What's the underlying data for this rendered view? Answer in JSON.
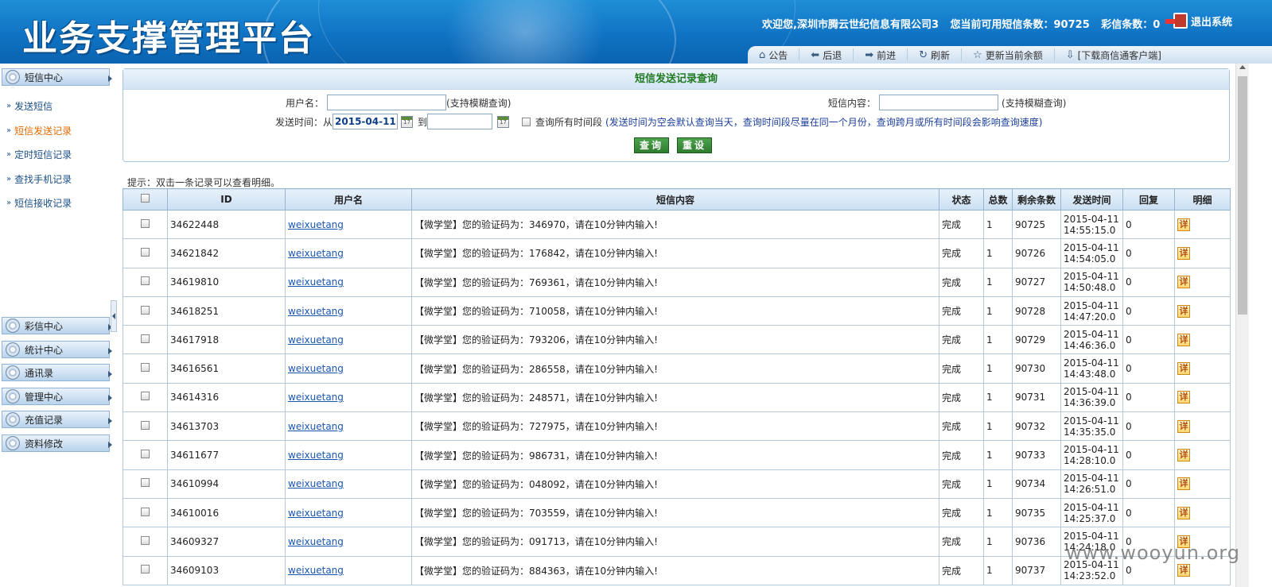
{
  "header": {
    "app_title": "业务支撑管理平台",
    "welcome": "欢迎您,深圳市腾云世纪信息有限公司3",
    "sms_available": "您当前可用短信条数：90725",
    "mms_count": "彩信条数：0",
    "logout": "退出系统"
  },
  "toolbar": [
    {
      "icon": "home-icon",
      "label": "公告"
    },
    {
      "icon": "back-arrow-icon",
      "label": "后退"
    },
    {
      "icon": "forward-arrow-icon",
      "label": "前进"
    },
    {
      "icon": "refresh-icon",
      "label": "刷新"
    },
    {
      "icon": "star-icon",
      "label": "更新当前余额"
    },
    {
      "icon": "download-icon",
      "label": "[下载商信通客户端]"
    }
  ],
  "sidebar": {
    "sms_center": "短信中心",
    "items": [
      {
        "label": "发送短信",
        "active": false
      },
      {
        "label": "短信发送记录",
        "active": true
      },
      {
        "label": "定时短信记录",
        "active": false
      },
      {
        "label": "查找手机记录",
        "active": false
      },
      {
        "label": "短信接收记录",
        "active": false
      }
    ],
    "sections": [
      "彩信中心",
      "统计中心",
      "通讯录",
      "管理中心",
      "充值记录",
      "资料修改"
    ]
  },
  "query": {
    "title": "短信发送记录查询",
    "username_label": "用户名：",
    "username_value": "",
    "fuzzy_hint": "(支持模糊查询)",
    "content_label": "短信内容：",
    "content_value": "",
    "time_label": "发送时间：从",
    "date_from": "2015-04-11",
    "to_label": "到",
    "date_to": "",
    "all_time_label": "查询所有时间段",
    "time_note": "(发送时间为空会默认查询当天，查询时间段尽量在同一个月份，查询跨月或所有时间段会影响查询速度)",
    "search_btn": "查询",
    "reset_btn": "重设"
  },
  "hint": "提示：双击一条记录可以查看明细。",
  "table": {
    "headers": [
      "",
      "ID",
      "用户名",
      "短信内容",
      "状态",
      "总数",
      "剩余条数",
      "发送时间",
      "回复",
      "明细"
    ],
    "detail_label": "详",
    "rows": [
      {
        "id": "34622448",
        "user": "weixuetang",
        "content": "【微学堂】您的验证码为：346970，请在10分钟内输入!",
        "status": "完成",
        "total": "1",
        "remain": "90725",
        "date": "2015-04-11",
        "time": "14:55:15.0",
        "reply": "0"
      },
      {
        "id": "34621842",
        "user": "weixuetang",
        "content": "【微学堂】您的验证码为：176842，请在10分钟内输入!",
        "status": "完成",
        "total": "1",
        "remain": "90726",
        "date": "2015-04-11",
        "time": "14:54:05.0",
        "reply": "0"
      },
      {
        "id": "34619810",
        "user": "weixuetang",
        "content": "【微学堂】您的验证码为：769361，请在10分钟内输入!",
        "status": "完成",
        "total": "1",
        "remain": "90727",
        "date": "2015-04-11",
        "time": "14:50:48.0",
        "reply": "0"
      },
      {
        "id": "34618251",
        "user": "weixuetang",
        "content": "【微学堂】您的验证码为：710058，请在10分钟内输入!",
        "status": "完成",
        "total": "1",
        "remain": "90728",
        "date": "2015-04-11",
        "time": "14:47:20.0",
        "reply": "0"
      },
      {
        "id": "34617918",
        "user": "weixuetang",
        "content": "【微学堂】您的验证码为：793206，请在10分钟内输入!",
        "status": "完成",
        "total": "1",
        "remain": "90729",
        "date": "2015-04-11",
        "time": "14:46:36.0",
        "reply": "0"
      },
      {
        "id": "34616561",
        "user": "weixuetang",
        "content": "【微学堂】您的验证码为：286558，请在10分钟内输入!",
        "status": "完成",
        "total": "1",
        "remain": "90730",
        "date": "2015-04-11",
        "time": "14:43:48.0",
        "reply": "0"
      },
      {
        "id": "34614316",
        "user": "weixuetang",
        "content": "【微学堂】您的验证码为：248571，请在10分钟内输入!",
        "status": "完成",
        "total": "1",
        "remain": "90731",
        "date": "2015-04-11",
        "time": "14:36:39.0",
        "reply": "0"
      },
      {
        "id": "34613703",
        "user": "weixuetang",
        "content": "【微学堂】您的验证码为：727975，请在10分钟内输入!",
        "status": "完成",
        "total": "1",
        "remain": "90732",
        "date": "2015-04-11",
        "time": "14:35:35.0",
        "reply": "0"
      },
      {
        "id": "34611677",
        "user": "weixuetang",
        "content": "【微学堂】您的验证码为：986731，请在10分钟内输入!",
        "status": "完成",
        "total": "1",
        "remain": "90733",
        "date": "2015-04-11",
        "time": "14:28:10.0",
        "reply": "0"
      },
      {
        "id": "34610994",
        "user": "weixuetang",
        "content": "【微学堂】您的验证码为：048092，请在10分钟内输入!",
        "status": "完成",
        "total": "1",
        "remain": "90734",
        "date": "2015-04-11",
        "time": "14:26:51.0",
        "reply": "0"
      },
      {
        "id": "34610016",
        "user": "weixuetang",
        "content": "【微学堂】您的验证码为：703559，请在10分钟内输入!",
        "status": "完成",
        "total": "1",
        "remain": "90735",
        "date": "2015-04-11",
        "time": "14:25:37.0",
        "reply": "0"
      },
      {
        "id": "34609327",
        "user": "weixuetang",
        "content": "【微学堂】您的验证码为：091713，请在10分钟内输入!",
        "status": "完成",
        "total": "1",
        "remain": "90736",
        "date": "2015-04-11",
        "time": "14:24:18.0",
        "reply": "0"
      },
      {
        "id": "34609103",
        "user": "weixuetang",
        "content": "【微学堂】您的验证码为：884363，请在10分钟内输入!",
        "status": "完成",
        "total": "1",
        "remain": "90737",
        "date": "2015-04-11",
        "time": "14:23:52.0",
        "reply": "0"
      }
    ]
  },
  "watermark": "www.wooyun.org"
}
